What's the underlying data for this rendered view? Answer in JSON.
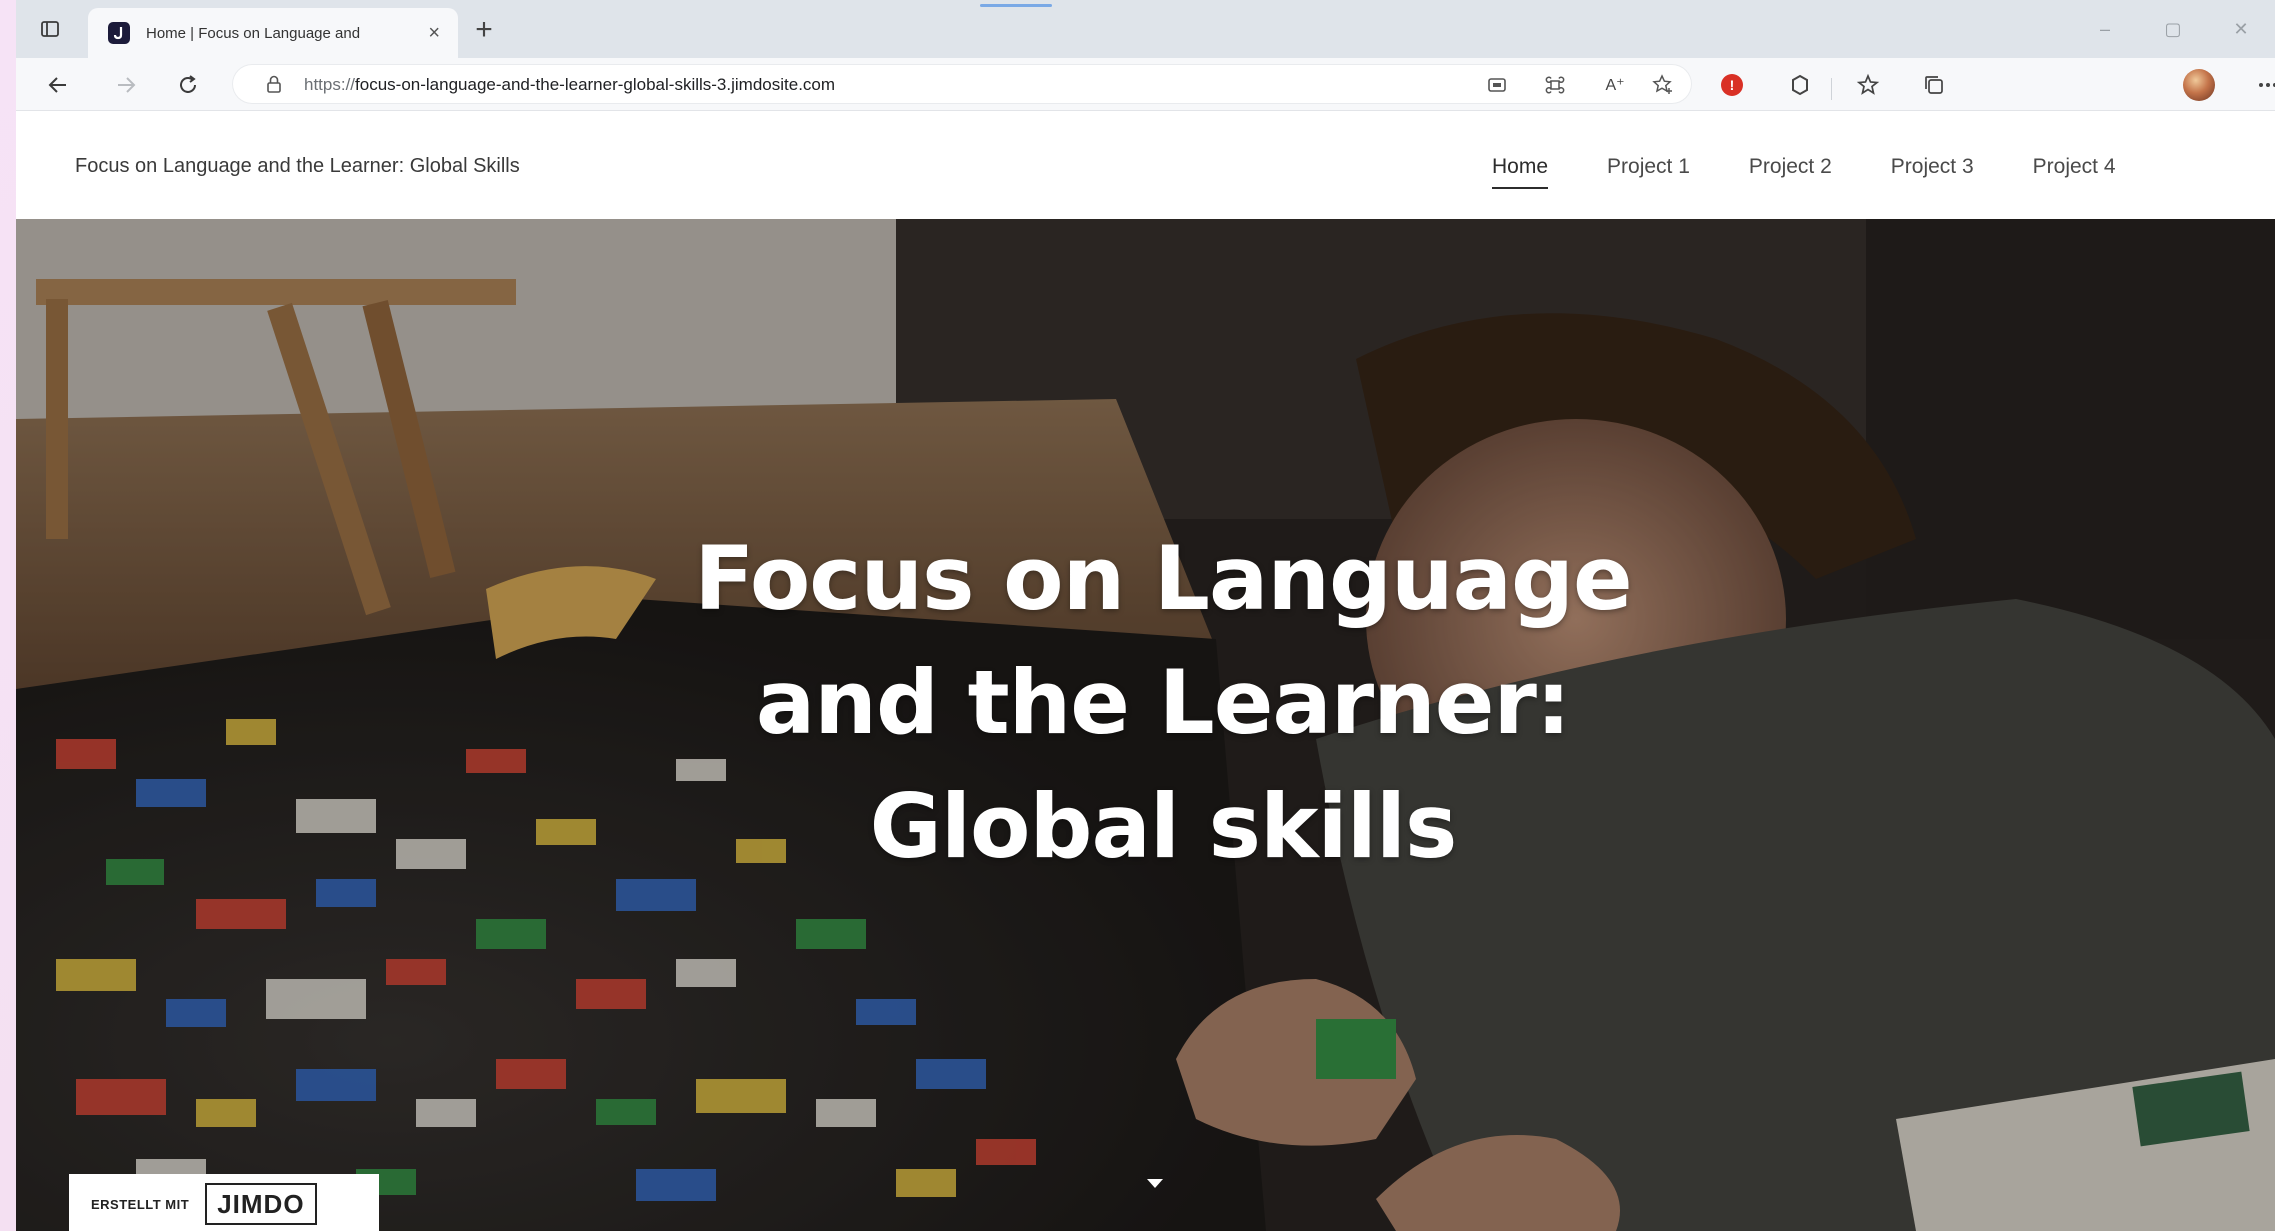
{
  "browser": {
    "tab": {
      "title": "Home | Focus on Language and",
      "close_glyph": "×",
      "favicon_icon": "jimdo-favicon-icon"
    },
    "new_tab_glyph": "+",
    "window_controls": {
      "minimize": "–",
      "maximize": "▢",
      "close": "✕"
    },
    "address": {
      "url_prefix": "https://",
      "url_host": "focus-on-language-and-the-learner-global-skills-3.jimdosite.com"
    },
    "toolbar_icons": [
      "back-icon",
      "forward-icon",
      "reload-icon",
      "lock-icon",
      "app-available-icon",
      "extension-icon",
      "read-aloud-icon",
      "add-favorite-icon",
      "adblock-icon",
      "extensions-puzzle-icon",
      "favorites-icon",
      "collections-icon",
      "profile-avatar",
      "more-menu-icon"
    ],
    "read_aloud_label": "A⁺"
  },
  "site": {
    "title": "Focus on Language and the Learner: Global Skills",
    "nav": [
      {
        "label": "Home",
        "active": true
      },
      {
        "label": "Project 1",
        "active": false
      },
      {
        "label": "Project 2",
        "active": false
      },
      {
        "label": "Project 3",
        "active": false
      },
      {
        "label": "Project 4",
        "active": false
      }
    ]
  },
  "hero": {
    "title_line1": "Focus on Language",
    "title_line2": "and the Learner:",
    "title_line3": "Global skills"
  },
  "badge": {
    "made_with": "ERSTELLT MIT",
    "brand": "JIMDO"
  },
  "colors": {
    "tabbar": "#dfe4ea",
    "toolbar": "#f7f8fa",
    "hero_text": "#ffffff",
    "adblock_red": "#d93025"
  }
}
